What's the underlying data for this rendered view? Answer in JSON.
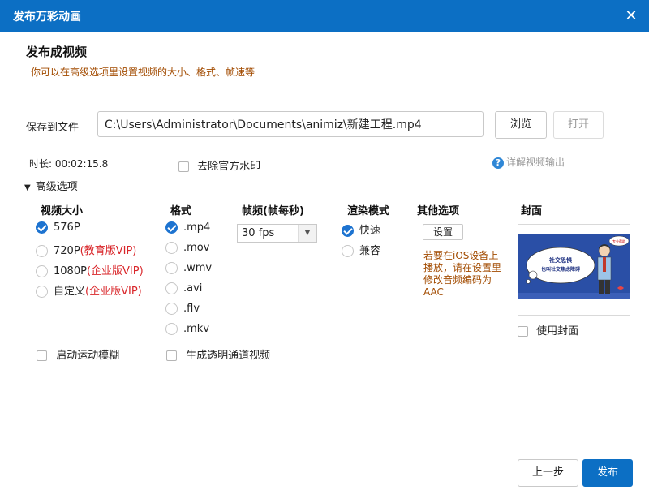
{
  "window": {
    "title": "发布万彩动画"
  },
  "header": {
    "heading": "发布成视频",
    "subtitle": "你可以在高级选项里设置视频的大小、格式、帧速等"
  },
  "save": {
    "label": "保存到文件",
    "path": "C:\\Users\\Administrator\\Documents\\animiz\\新建工程.mp4",
    "browse": "浏览",
    "open": "打开"
  },
  "duration": "时长: 00:02:15.8",
  "watermark": {
    "label": "去除官方水印",
    "checked": false
  },
  "help": {
    "label": "详解视频输出"
  },
  "advanced": {
    "label": "高级选项",
    "expanded": true
  },
  "size": {
    "header": "视频大小",
    "options": [
      {
        "label": "576P",
        "vip": "",
        "checked": true
      },
      {
        "label": "720P",
        "vip": "(教育版VIP)",
        "checked": false
      },
      {
        "label": "1080P",
        "vip": "(企业版VIP)",
        "checked": false
      },
      {
        "label": "自定义",
        "vip": "(企业版VIP)",
        "checked": false
      }
    ]
  },
  "format": {
    "header": "格式",
    "options": [
      {
        "label": ".mp4",
        "checked": true
      },
      {
        "label": ".mov",
        "checked": false
      },
      {
        "label": ".wmv",
        "checked": false
      },
      {
        "label": ".avi",
        "checked": false
      },
      {
        "label": ".flv",
        "checked": false
      },
      {
        "label": ".mkv",
        "checked": false
      }
    ]
  },
  "framerate": {
    "header": "帧频(帧每秒)",
    "value": "30 fps"
  },
  "render": {
    "header": "渲染模式",
    "options": [
      {
        "label": "快速",
        "checked": true
      },
      {
        "label": "兼容",
        "checked": false
      }
    ]
  },
  "other": {
    "header": "其他选项",
    "settings": "设置",
    "note": "若要在iOS设备上播放，请在设置里修改音频编码为AAC"
  },
  "cover": {
    "header": "封面",
    "use_label": "使用封面",
    "checked": false,
    "bubble_title": "社交恐惧",
    "bubble_text": "也叫社交焦虑障碍",
    "tag_text": "专业帮助"
  },
  "motion_blur": {
    "label": "启动运动模糊",
    "checked": false
  },
  "alpha_video": {
    "label": "生成透明通道视频",
    "checked": false
  },
  "footer": {
    "prev": "上一步",
    "publish": "发布"
  },
  "colors": {
    "titlebar": "#0c6fc4",
    "accent": "#1d73d0",
    "note": "#a24b00",
    "vip": "#d9262a"
  }
}
